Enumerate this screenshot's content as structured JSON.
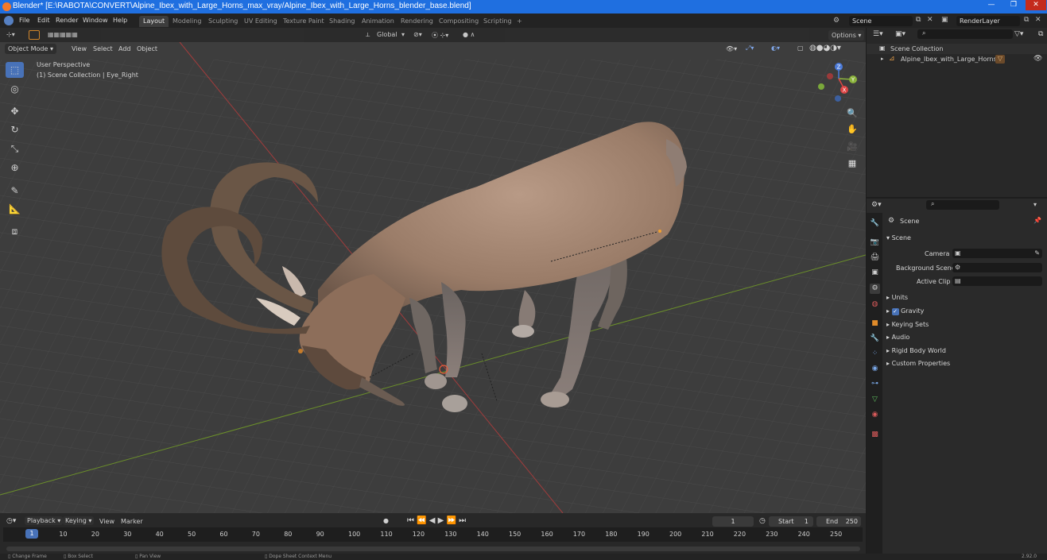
{
  "window": {
    "title": "Blender* [E:\\RABOTA\\CONVERT\\Alpine_Ibex_with_Large_Horns_max_vray/Alpine_Ibex_with_Large_Horns_blender_base.blend]",
    "min": "—",
    "max": "❐",
    "close": "✕"
  },
  "menu": [
    "File",
    "Edit",
    "Render",
    "Window",
    "Help"
  ],
  "workspaces": [
    "Layout",
    "Modeling",
    "Sculpting",
    "UV Editing",
    "Texture Paint",
    "Shading",
    "Animation",
    "Rendering",
    "Compositing",
    "Scripting"
  ],
  "add_workspace": "+",
  "scene_field": "Scene",
  "renderlayer_field": "RenderLayer",
  "viewport": {
    "transform_orientation": "Global",
    "options": "Options",
    "mode": "Object Mode",
    "menus": [
      "View",
      "Select",
      "Add",
      "Object"
    ],
    "perspective": "User Perspective",
    "collection_info": "(1) Scene Collection | Eye_Right",
    "axes": {
      "x": "X",
      "y": "Y",
      "z": "Z"
    }
  },
  "tools": [
    "select-box",
    "cursor",
    "move",
    "rotate",
    "scale",
    "transform",
    "annotate",
    "measure",
    "add-cube"
  ],
  "outliner": {
    "root": "Scene Collection",
    "item": "Alpine_Ibex_with_Large_Horns"
  },
  "properties": {
    "header": "Scene",
    "panel": "Scene",
    "camera_label": "Camera",
    "background_scene_label": "Background Scene",
    "active_clip_label": "Active Clip",
    "sections": [
      "Units",
      "Gravity",
      "Keying Sets",
      "Audio",
      "Rigid Body World",
      "Custom Properties"
    ],
    "gravity_checked": true
  },
  "timeline": {
    "menus": [
      "Playback",
      "Keying",
      "View",
      "Marker"
    ],
    "current_frame": "1",
    "start_label": "Start",
    "start": "1",
    "end_label": "End",
    "end": "250",
    "ruler": [
      "10",
      "20",
      "30",
      "40",
      "50",
      "60",
      "70",
      "80",
      "90",
      "100",
      "110",
      "120",
      "130",
      "140",
      "150",
      "160",
      "170",
      "180",
      "190",
      "200",
      "210",
      "220",
      "230",
      "240",
      "250"
    ],
    "playhead": "1"
  },
  "statusbar": {
    "items": [
      "Change Frame",
      "Box Select",
      "Pan View",
      "Dope Sheet Context Menu"
    ],
    "version": "2.92.0"
  }
}
